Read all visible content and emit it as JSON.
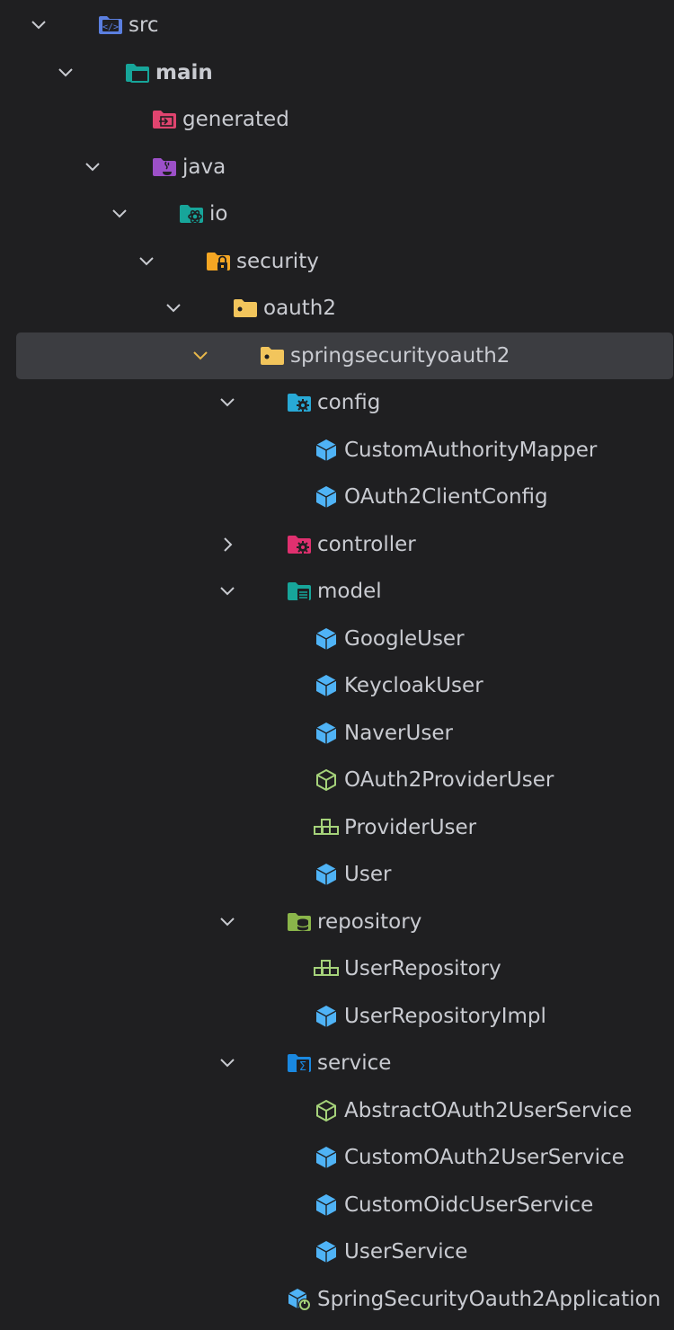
{
  "tree": {
    "items": [
      {
        "label": "src",
        "icon": "source-root-folder-icon",
        "chevron": "down",
        "depth": 0
      },
      {
        "label": "main",
        "icon": "module-folder-icon",
        "chevron": "down",
        "depth": 1,
        "bold": true
      },
      {
        "label": "generated",
        "icon": "generated-folder-icon",
        "chevron": "none",
        "depth": 2
      },
      {
        "label": "java",
        "icon": "java-source-folder-icon",
        "chevron": "down",
        "depth": 2
      },
      {
        "label": "io",
        "icon": "package-io-folder-icon",
        "chevron": "down",
        "depth": 3
      },
      {
        "label": "security",
        "icon": "security-folder-icon",
        "chevron": "down",
        "depth": 4
      },
      {
        "label": "oauth2",
        "icon": "package-folder-icon",
        "chevron": "down",
        "depth": 5
      },
      {
        "label": "springsecurityoauth2",
        "icon": "package-folder-icon",
        "chevron": "down",
        "depth": 6,
        "selected": true
      },
      {
        "label": "config",
        "icon": "config-folder-icon",
        "chevron": "down",
        "depth": 7
      },
      {
        "label": "CustomAuthorityMapper",
        "icon": "class-icon",
        "chevron": "none",
        "depth": 8
      },
      {
        "label": "OAuth2ClientConfig",
        "icon": "class-icon",
        "chevron": "none",
        "depth": 8
      },
      {
        "label": "controller",
        "icon": "controller-folder-icon",
        "chevron": "right",
        "depth": 7
      },
      {
        "label": "model",
        "icon": "model-folder-icon",
        "chevron": "down",
        "depth": 7
      },
      {
        "label": "GoogleUser",
        "icon": "class-icon",
        "chevron": "none",
        "depth": 8
      },
      {
        "label": "KeycloakUser",
        "icon": "class-icon",
        "chevron": "none",
        "depth": 8
      },
      {
        "label": "NaverUser",
        "icon": "class-icon",
        "chevron": "none",
        "depth": 8
      },
      {
        "label": "OAuth2ProviderUser",
        "icon": "abstract-class-icon",
        "chevron": "none",
        "depth": 8
      },
      {
        "label": "ProviderUser",
        "icon": "interface-icon",
        "chevron": "none",
        "depth": 8
      },
      {
        "label": "User",
        "icon": "class-icon",
        "chevron": "none",
        "depth": 8
      },
      {
        "label": "repository",
        "icon": "repository-folder-icon",
        "chevron": "down",
        "depth": 7
      },
      {
        "label": "UserRepository",
        "icon": "interface-icon",
        "chevron": "none",
        "depth": 8
      },
      {
        "label": "UserRepositoryImpl",
        "icon": "class-icon",
        "chevron": "none",
        "depth": 8
      },
      {
        "label": "service",
        "icon": "service-folder-icon",
        "chevron": "down",
        "depth": 7
      },
      {
        "label": "AbstractOAuth2UserService",
        "icon": "abstract-class-icon",
        "chevron": "none",
        "depth": 8
      },
      {
        "label": "CustomOAuth2UserService",
        "icon": "class-icon",
        "chevron": "none",
        "depth": 8
      },
      {
        "label": "CustomOidcUserService",
        "icon": "class-icon",
        "chevron": "none",
        "depth": 8
      },
      {
        "label": "UserService",
        "icon": "class-icon",
        "chevron": "none",
        "depth": 8
      },
      {
        "label": "SpringSecurityOauth2Application",
        "icon": "spring-boot-application-class-icon",
        "chevron": "none",
        "depth": 7
      }
    ]
  },
  "colors": {
    "background": "#1f1f21",
    "selection": "#3c3d41",
    "text": "#c9cbd1",
    "class": "#4fb3f6",
    "interface_abstract": "#a5d27a",
    "folder_package": "#f2c55c",
    "folder_security": "#f5a623",
    "folder_config": "#28a9d6",
    "folder_controller": "#e0306f",
    "folder_model": "#17a59a",
    "folder_repository": "#8ab54a",
    "folder_service": "#1a88e0",
    "folder_generated": "#e0446f",
    "folder_java": "#9c50c8",
    "folder_src": "#5b7fe0"
  }
}
